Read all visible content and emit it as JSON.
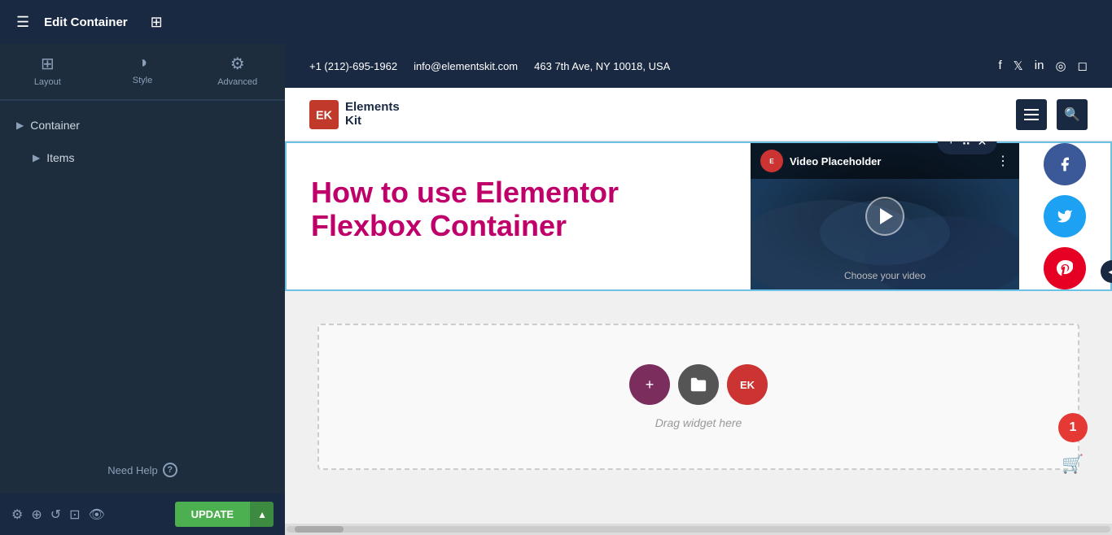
{
  "topbar": {
    "hamburger_label": "☰",
    "title": "Edit Container",
    "grid_icon": "⊞",
    "title_label": "Edit Container"
  },
  "sidebar": {
    "tabs": [
      {
        "id": "layout",
        "label": "Layout",
        "icon": "⊞",
        "active": true
      },
      {
        "id": "style",
        "label": "Style",
        "icon": "◑",
        "active": false
      },
      {
        "id": "advanced",
        "label": "Advanced",
        "icon": "⚙",
        "active": false
      }
    ],
    "items": [
      {
        "id": "container",
        "label": "Container",
        "indent": 0
      },
      {
        "id": "items",
        "label": "Items",
        "indent": 1
      }
    ],
    "need_help_label": "Need Help",
    "update_label": "UPDATE",
    "update_dropdown_icon": "▲",
    "bottom_icons": [
      "⚙",
      "⊕",
      "↺",
      "⊡",
      "👁"
    ]
  },
  "site_header": {
    "phone": "+1 (212)-695-1962",
    "email": "info@elementskit.com",
    "address": "463 7th Ave, NY 10018, USA",
    "social": [
      "f",
      "t",
      "in",
      "d",
      "ig"
    ]
  },
  "site_logo_bar": {
    "logo_letters": "EK",
    "logo_line1": "Elements",
    "logo_line2": "Kit",
    "hamburger_label": "☰",
    "search_icon": "🔍"
  },
  "video_section": {
    "floating_plus": "+",
    "floating_dots": "⠿",
    "floating_close": "✕",
    "heading": "How to use Elementor Flexbox Container",
    "heading_color": "#c0006a",
    "video_title": "Video Placeholder",
    "video_choose": "Choose your video",
    "elementor_badge": "E",
    "video_menu": "⋮",
    "social_buttons": [
      {
        "id": "facebook",
        "icon": "f",
        "color": "#3b5998"
      },
      {
        "id": "twitter",
        "icon": "t",
        "color": "#1da1f2"
      },
      {
        "id": "pinterest",
        "icon": "p",
        "color": "#e60023"
      }
    ]
  },
  "drag_section": {
    "add_icon": "+",
    "folder_icon": "▤",
    "ek_icon": "EK",
    "drag_text": "Drag widget here"
  },
  "floating_widgets": {
    "notification_count": "1",
    "cart_icon": "🛒"
  },
  "colors": {
    "accent_blue": "#6ec1e4",
    "heading_pink": "#c0006a",
    "dark_navy": "#1a2942",
    "sidebar_bg": "#1e2d3d"
  }
}
